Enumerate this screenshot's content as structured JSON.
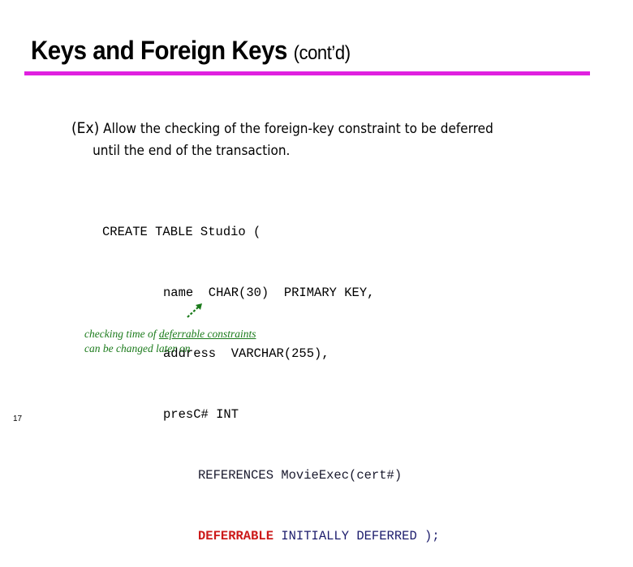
{
  "slide": {
    "title": "Keys and Foreign Keys",
    "title_suffix": "(cont’d)",
    "accent_color": "#e020e0",
    "example": {
      "lead": "(Ex)",
      "line1": "Allow the checking of the foreign-key constraint to be deferred",
      "line2": "until the end of the transaction."
    },
    "code": {
      "line1": "CREATE TABLE Studio (",
      "line2": "name  CHAR(30)  PRIMARY KEY,",
      "line3": "address  VARCHAR(255),",
      "line4": "presC# INT",
      "line5": "REFERENCES MovieExec(cert#)",
      "line6_keyword": "DEFERRABLE",
      "line6_rest": " INITIALLY DEFERRED );"
    },
    "annotation": {
      "prefix": "checking time of ",
      "underlined": "deferrable constraints",
      "line2": "can be changed later on"
    },
    "page_number": "17"
  }
}
